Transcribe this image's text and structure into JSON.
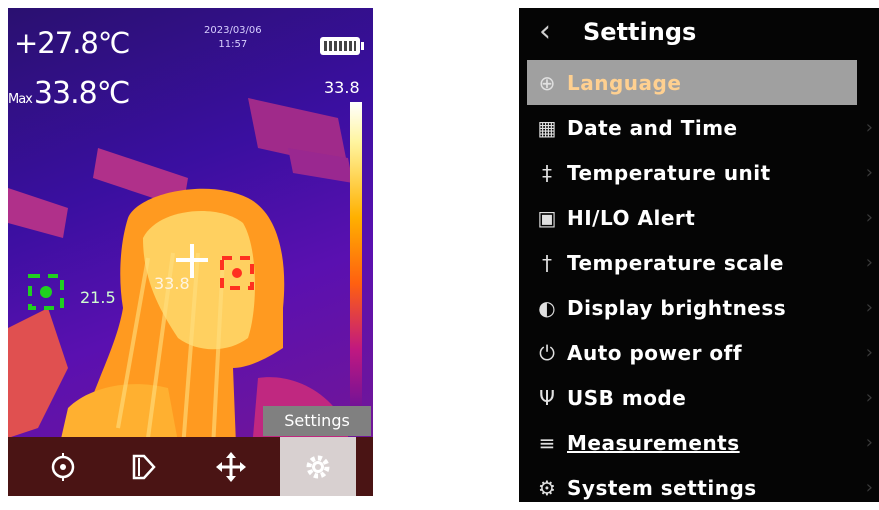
{
  "camera": {
    "center_temp": "+27.8℃",
    "max_label": "Max",
    "max_temp": "33.8℃",
    "date": "2023/03/06",
    "time": "11:57",
    "scale_max": "33.8",
    "spot_min": "21.5",
    "spot_center": "33.8",
    "settings_tip": "Settings",
    "toolbar": [
      "target-icon",
      "palette-icon",
      "move-icon",
      "gear-icon"
    ]
  },
  "menu": {
    "back_icon": "‹",
    "title": "Settings",
    "items": [
      {
        "icon": "⊕",
        "label": "Language"
      },
      {
        "icon": "▦",
        "label": "Date and Time"
      },
      {
        "icon": "‡",
        "label": "Temperature unit"
      },
      {
        "icon": "▣",
        "label": "HI/LO Alert"
      },
      {
        "icon": "†",
        "label": "Temperature scale"
      },
      {
        "icon": "◐",
        "label": "Display brightness"
      },
      {
        "icon": "⏻",
        "label": "Auto power off"
      },
      {
        "icon": "Ψ",
        "label": "USB mode"
      },
      {
        "icon": "≡",
        "label": "Measurements"
      },
      {
        "icon": "⚙",
        "label": "System settings"
      }
    ],
    "chevron": "›"
  }
}
